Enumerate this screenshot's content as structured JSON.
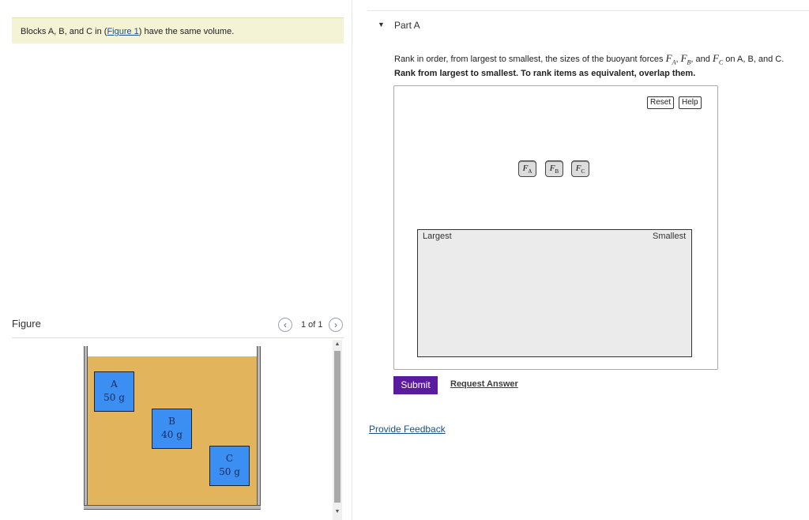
{
  "problem": {
    "text_before": "Blocks A, B, and C in (",
    "figure_link": "Figure 1",
    "text_after": ") have the same volume."
  },
  "figure": {
    "label": "Figure",
    "prev_icon": "chevron-left-icon",
    "next_icon": "chevron-right-icon",
    "page_count": "1 of 1",
    "blocks": [
      {
        "letter": "A",
        "mass": "50 g"
      },
      {
        "letter": "B",
        "mass": "40 g"
      },
      {
        "letter": "C",
        "mass": "50 g"
      }
    ],
    "colors": {
      "water": "#e2b55d",
      "block": "#3b8ef2"
    }
  },
  "part": {
    "title": "Part A",
    "question_prefix": "Rank in order, from largest to smallest, the sizes of the buoyant forces ",
    "question_suffix": " on A, B, and C.",
    "instruction": "Rank from largest to smallest. To rank items as equivalent, overlap them.",
    "reset_label": "Reset",
    "help_label": "Help",
    "tiles": [
      {
        "symbol": "F",
        "sub": "A"
      },
      {
        "symbol": "F",
        "sub": "B"
      },
      {
        "symbol": "F",
        "sub": "C"
      }
    ],
    "largest_label": "Largest",
    "smallest_label": "Smallest",
    "submit_label": "Submit",
    "request_answer_label": "Request Answer",
    "submit_color": "#5b1b9e"
  },
  "feedback": {
    "label": "Provide Feedback"
  }
}
